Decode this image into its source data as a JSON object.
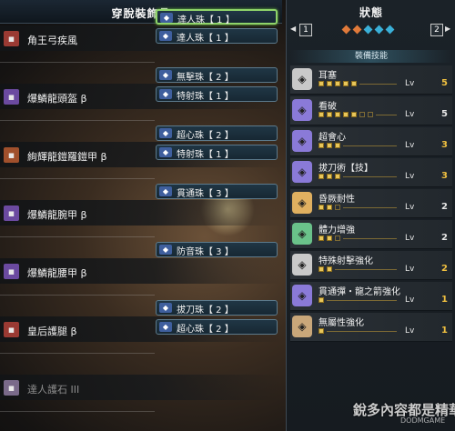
{
  "left_panel": {
    "title": "穿脫裝飾品",
    "slots": [
      {
        "name": "角王弓疾風",
        "icon": "bow-icon",
        "icon_color": "#9a3a33",
        "decorations": [
          {
            "label": "達人珠【 1 】",
            "selected": true
          },
          {
            "label": "達人珠【 1 】",
            "selected": false
          }
        ]
      },
      {
        "name": "爆鱗龍頭盔 β",
        "icon": "helmet-icon",
        "icon_color": "#6b4aa0",
        "decorations": [
          {
            "label": "無擊珠【 2 】"
          },
          {
            "label": "特射珠【 1 】"
          }
        ]
      },
      {
        "name": "絢輝龍鎧羅鎧甲 β",
        "icon": "chest-armor-icon",
        "icon_color": "#a0502c",
        "decorations": [
          {
            "label": "超心珠【 2 】"
          },
          {
            "label": "特射珠【 1 】"
          }
        ]
      },
      {
        "name": "爆鱗龍腕甲 β",
        "icon": "gauntlet-icon",
        "icon_color": "#6b4aa0",
        "decorations": [
          {
            "label": "貫通珠【 3 】"
          }
        ]
      },
      {
        "name": "爆鱗龍腰甲 β",
        "icon": "waist-armor-icon",
        "icon_color": "#6b4aa0",
        "decorations": [
          {
            "label": "防音珠【 3 】"
          }
        ]
      },
      {
        "name": "皇后護腿 β",
        "icon": "leg-armor-icon",
        "icon_color": "#9a3a33",
        "decorations": [
          {
            "label": "拔刀珠【 2 】"
          },
          {
            "label": "超心珠【 2 】"
          }
        ]
      },
      {
        "name": "達人護石 III",
        "icon": "charm-icon",
        "icon_color": "#7a6a8a",
        "dim": true,
        "decorations": []
      }
    ]
  },
  "right_panel": {
    "title": "狀態",
    "pager": {
      "left": "1",
      "right": "2"
    },
    "subheader": "裝備技能",
    "skills": [
      {
        "name": "耳塞",
        "icon": "earplug-icon",
        "icon_color": "#c9c9c9",
        "filled": 5,
        "max": 5,
        "level_label": "Lv",
        "level": "5",
        "level_color": "#f0c040"
      },
      {
        "name": "看破",
        "icon": "eye-icon",
        "icon_color": "#8a7ad8",
        "filled": 5,
        "max": 7,
        "level_label": "Lv",
        "level": "5",
        "level_color": "#e6e6e6"
      },
      {
        "name": "超會心",
        "icon": "crit-icon",
        "icon_color": "#8a7ad8",
        "filled": 3,
        "max": 3,
        "level_label": "Lv",
        "level": "3",
        "level_color": "#f0c040"
      },
      {
        "name": "拔刀術【技】",
        "icon": "draw-icon",
        "icon_color": "#8a7ad8",
        "filled": 3,
        "max": 3,
        "level_label": "Lv",
        "level": "3",
        "level_color": "#f0c040"
      },
      {
        "name": "昏厥耐性",
        "icon": "stun-icon",
        "icon_color": "#e0b060",
        "filled": 2,
        "max": 3,
        "level_label": "Lv",
        "level": "2",
        "level_color": "#e6e6e6"
      },
      {
        "name": "體力增強",
        "icon": "health-icon",
        "icon_color": "#6ac28a",
        "filled": 2,
        "max": 3,
        "level_label": "Lv",
        "level": "2",
        "level_color": "#e6e6e6"
      },
      {
        "name": "特殊射擊強化",
        "icon": "special-shot-icon",
        "icon_color": "#c9c9c9",
        "filled": 2,
        "max": 2,
        "level_label": "Lv",
        "level": "2",
        "level_color": "#f0c040"
      },
      {
        "name": "貫通彈・龍之箭強化",
        "icon": "pierce-icon",
        "icon_color": "#8a7ad8",
        "filled": 1,
        "max": 1,
        "level_label": "Lv",
        "level": "1",
        "level_color": "#f0c040"
      },
      {
        "name": "無屬性強化",
        "icon": "non-element-icon",
        "icon_color": "#c9a77a",
        "filled": 1,
        "max": 1,
        "level_label": "Lv",
        "level": "1",
        "level_color": "#f0c040"
      }
    ]
  },
  "watermark": {
    "line1": "銳多內容都是精華",
    "line2": "DODMGAME"
  }
}
